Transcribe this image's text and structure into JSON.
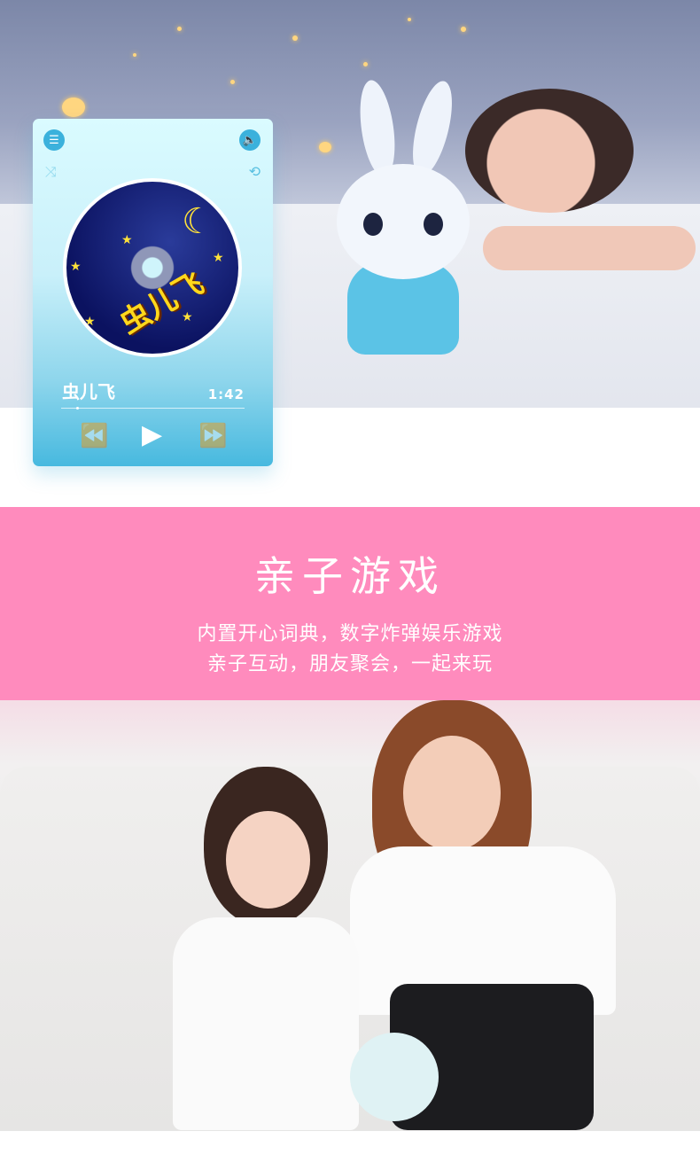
{
  "player": {
    "song_title": "虫儿飞",
    "time": "1:42",
    "progress": 0.08,
    "album_art_text": "虫儿飞",
    "icons": {
      "menu": "menu-icon",
      "volume": "volume-icon",
      "shuffle": "shuffle-icon",
      "repeat": "repeat-icon",
      "rewind": "rewind-icon",
      "play": "play-icon",
      "fast_forward": "fast-forward-icon"
    }
  },
  "section": {
    "title": "亲子游戏",
    "line1": "内置开心词典，数字炸弹娱乐游戏",
    "line2": "亲子互动，朋友聚会，一起来玩",
    "color": "#ff8bbd"
  },
  "accent": "#3bb1dc"
}
